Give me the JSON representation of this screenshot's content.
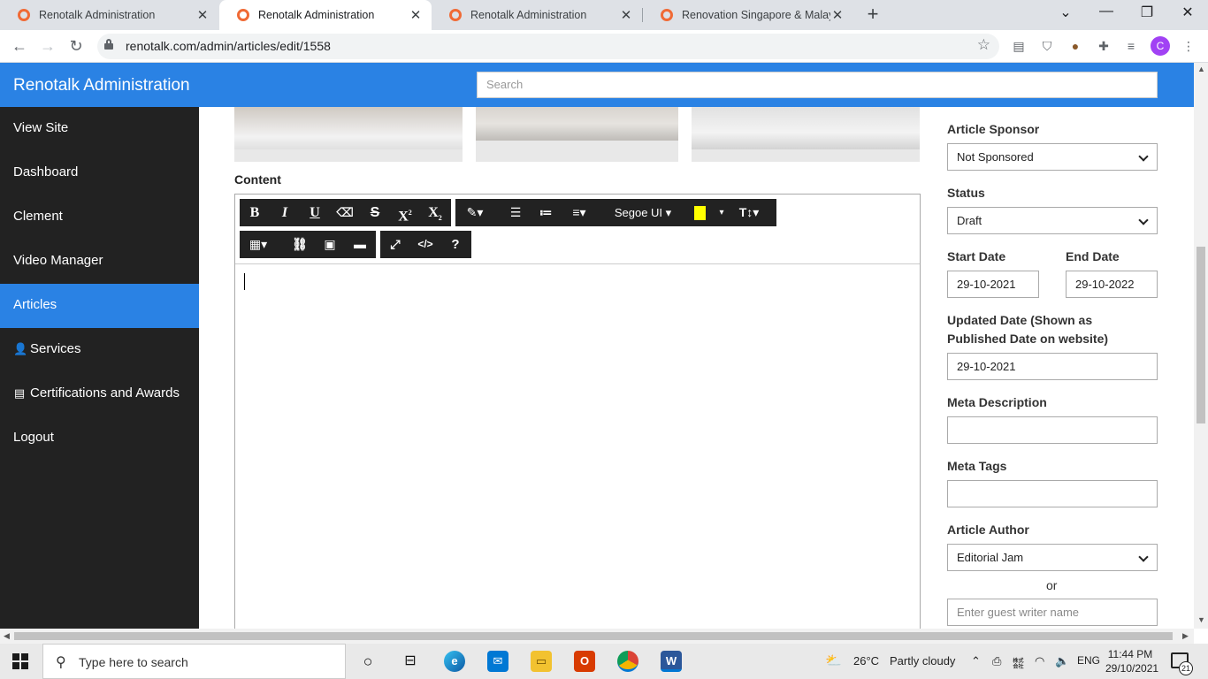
{
  "browser": {
    "tabs": [
      {
        "title": "Renotalk Administration",
        "active": false
      },
      {
        "title": "Renotalk Administration",
        "active": true
      },
      {
        "title": "Renotalk Administration",
        "active": false
      },
      {
        "title": "Renovation Singapore & Malaysi",
        "active": false
      }
    ],
    "url": "renotalk.com/admin/articles/edit/1558",
    "profile_initial": "C"
  },
  "header": {
    "brand": "Renotalk Administration",
    "search_placeholder": "Search"
  },
  "sidebar": {
    "items": [
      {
        "label": "View Site",
        "icon": "",
        "active": false
      },
      {
        "label": "Dashboard",
        "icon": "",
        "active": false
      },
      {
        "label": "Clement",
        "icon": "",
        "active": false
      },
      {
        "label": "Video Manager",
        "icon": "",
        "active": false
      },
      {
        "label": "Articles",
        "icon": "",
        "active": true
      },
      {
        "label": "Services",
        "icon": "user-icon",
        "active": false
      },
      {
        "label": "Certifications and Awards",
        "icon": "document-icon",
        "active": false
      },
      {
        "label": "Logout",
        "icon": "",
        "active": false
      }
    ]
  },
  "editor": {
    "content_label": "Content",
    "font_name": "Segoe UI",
    "toolbar_icons": [
      "bold-icon",
      "italic-icon",
      "underline-icon",
      "eraser-icon",
      "strikethrough-icon",
      "superscript-icon",
      "subscript-icon",
      "magic-icon",
      "unordered-list-icon",
      "ordered-list-icon",
      "align-icon",
      "font-family-dropdown",
      "highlight-color-icon",
      "color-dropdown-icon",
      "font-size-icon",
      "table-icon",
      "link-icon",
      "image-icon",
      "video-icon",
      "fullscreen-icon",
      "code-view-icon",
      "help-icon"
    ]
  },
  "form": {
    "sponsor": {
      "label": "Article Sponsor",
      "value": "Not Sponsored"
    },
    "status": {
      "label": "Status",
      "value": "Draft"
    },
    "start_date": {
      "label": "Start Date",
      "value": "29-10-2021"
    },
    "end_date": {
      "label": "End Date",
      "value": "29-10-2022"
    },
    "updated_date": {
      "label": "Updated Date (Shown as Published Date on website)",
      "value": "29-10-2021"
    },
    "meta_description": {
      "label": "Meta Description",
      "value": ""
    },
    "meta_tags": {
      "label": "Meta Tags",
      "value": ""
    },
    "author": {
      "label": "Article Author",
      "value": "Editorial Jam"
    },
    "or_text": "or",
    "guest_writer": {
      "placeholder": "Enter guest writer name"
    }
  },
  "taskbar": {
    "search_placeholder": "Type here to search",
    "weather_temp": "26°C",
    "weather_desc": "Partly cloudy",
    "language": "ENG",
    "time": "11:44 PM",
    "date": "29/10/2021",
    "notification_count": "21"
  }
}
